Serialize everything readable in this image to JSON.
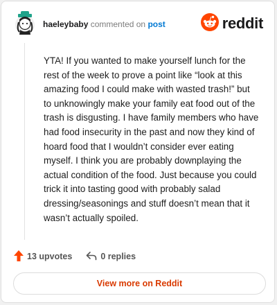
{
  "header": {
    "username": "haeleybaby",
    "commented_text": "commented on",
    "post_link": "post",
    "brand_word": "reddit"
  },
  "comment": {
    "body": "YTA! If you wanted to make yourself lunch for the rest of the week to prove a point like “look at this amazing food I could make with wasted trash!” but to unknowingly make your family eat food out of the trash is disgusting. I have family members who have had food insecurity in the past and now they kind of hoard food that I wouldn’t consider ever eating myself. I think you are probably downplaying the actual condition of the food. Just because you could trick it into tasting good with probably salad dressing/seasonings and stuff doesn’t mean that it wasn’t actually spoiled."
  },
  "actions": {
    "upvotes": "13 upvotes",
    "replies": "0 replies"
  },
  "cta": {
    "label": "View more on Reddit"
  },
  "icons": [
    "avatar",
    "reddit-logo-icon",
    "upvote-arrow-icon",
    "reply-arrow-icon"
  ],
  "colors": {
    "brand_orange": "#ff4500",
    "link_blue": "#0079d3",
    "cta_text": "#d93a00"
  }
}
